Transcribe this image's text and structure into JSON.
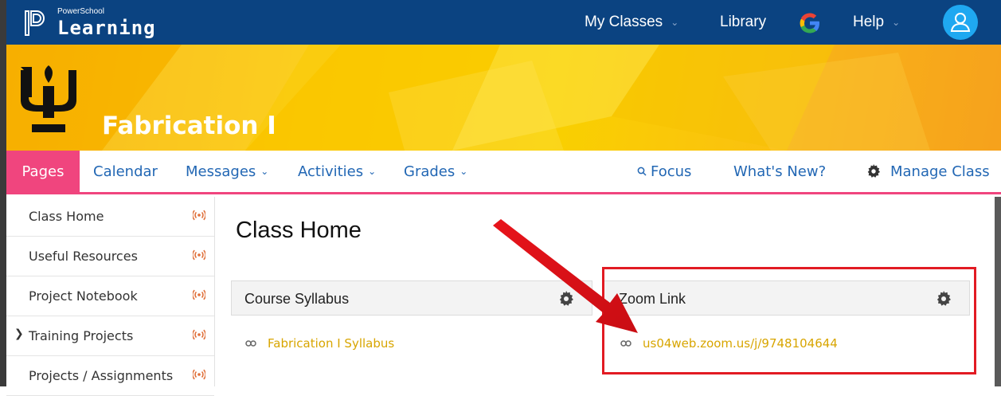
{
  "app": {
    "brand_small": "PowerSchool",
    "brand_big": "Learning"
  },
  "topnav": {
    "my_classes": "My Classes",
    "library": "Library",
    "help": "Help"
  },
  "banner": {
    "class_title": "Fabrication I"
  },
  "classnav": {
    "pages": "Pages",
    "calendar": "Calendar",
    "messages": "Messages",
    "activities": "Activities",
    "grades": "Grades",
    "focus": "Focus",
    "whats_new": "What's New?",
    "manage_class": "Manage Class"
  },
  "sidebar": {
    "items": [
      {
        "label": "Class Home"
      },
      {
        "label": "Useful Resources"
      },
      {
        "label": "Project Notebook"
      },
      {
        "label": "Training Projects"
      },
      {
        "label": "Projects / Assignments"
      }
    ]
  },
  "content": {
    "title": "Class Home",
    "panels": [
      {
        "title": "Course Syllabus",
        "link": "Fabrication I Syllabus"
      },
      {
        "title": "Zoom Link",
        "link": "us04web.zoom.us/j/9748104644"
      }
    ]
  },
  "colors": {
    "topbar": "#0b4381",
    "accent_pink": "#f0457e",
    "link_gold": "#d8a500",
    "annotation_red": "#e21b23"
  },
  "icons": [
    "powerschool-logo-icon",
    "google-icon",
    "user-icon",
    "chevron-down-icon",
    "search-icon",
    "gear-icon",
    "rss-icon",
    "chain-link-icon",
    "chevron-right-icon"
  ]
}
